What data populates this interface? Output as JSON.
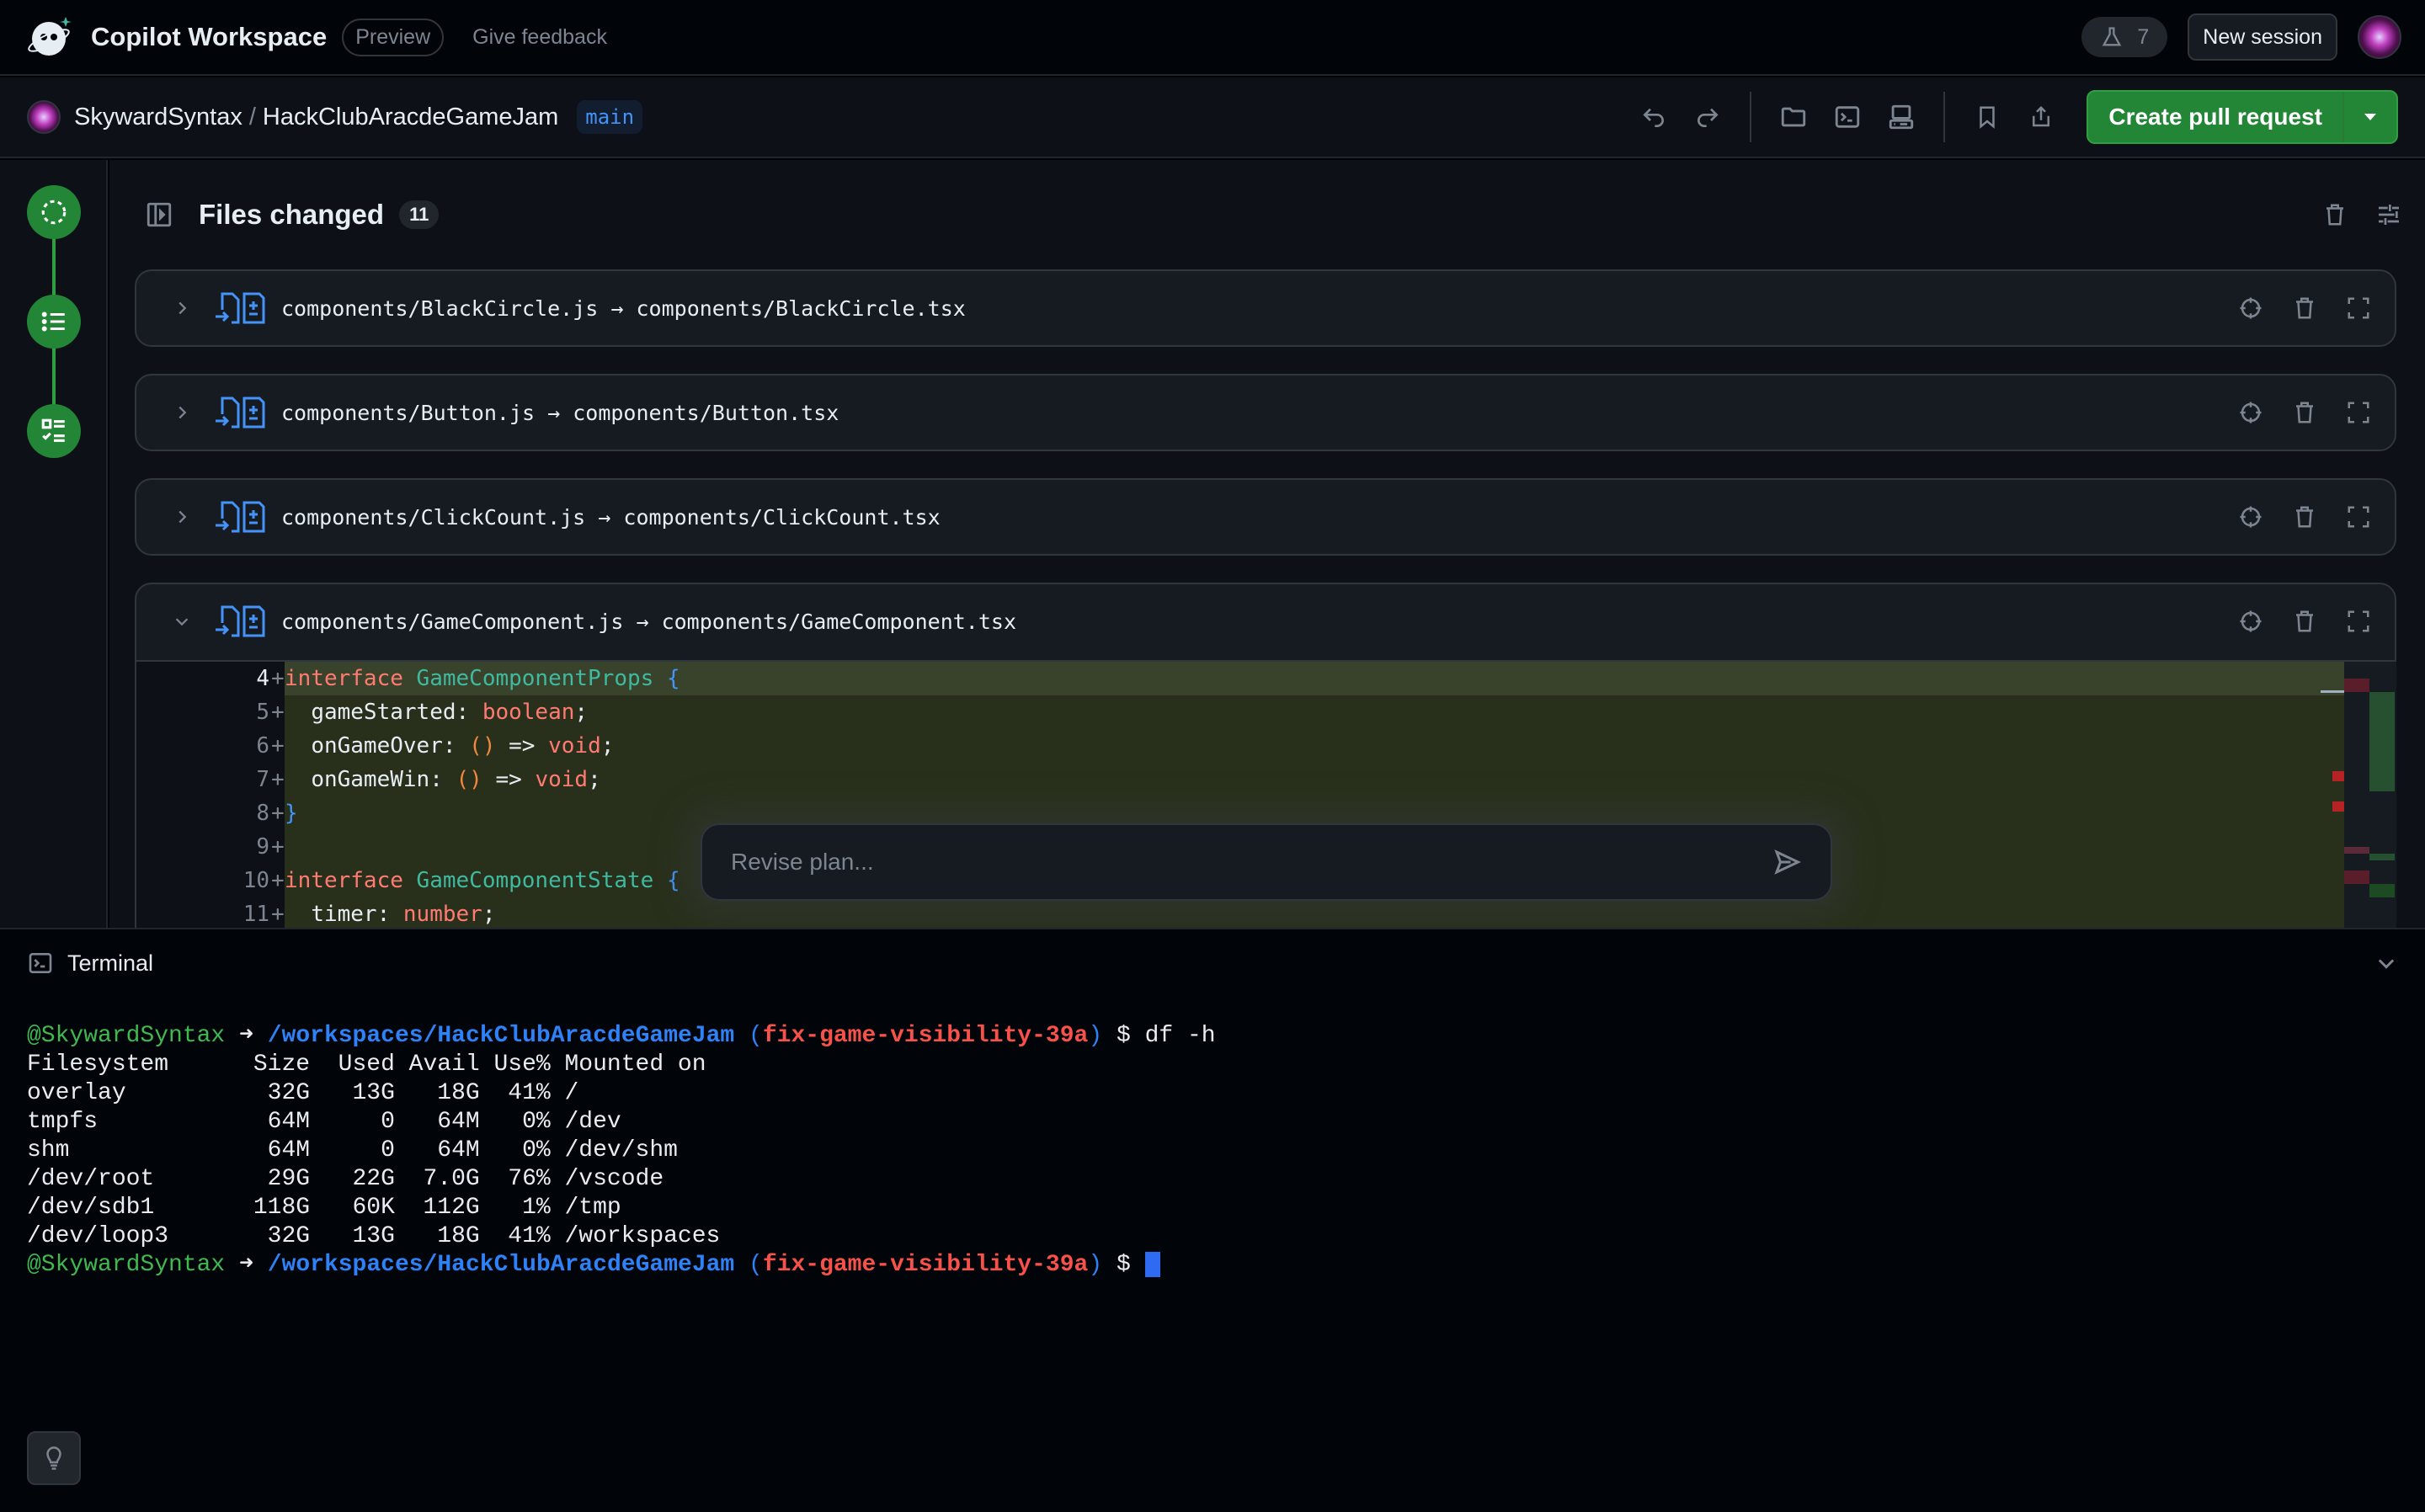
{
  "header": {
    "app_title": "Copilot Workspace",
    "preview_badge": "Preview",
    "feedback_link": "Give feedback",
    "flask_count": "7",
    "new_session_label": "New session"
  },
  "repo": {
    "owner": "SkywardSyntax",
    "separator": "/",
    "name": "HackClubAracdeGameJam",
    "branch": "main"
  },
  "toolbar": {
    "icons": [
      "undo-icon",
      "redo-icon",
      "folder-icon",
      "terminal-icon",
      "codespace-icon",
      "bookmark-icon",
      "share-icon"
    ],
    "create_pr_label": "Create pull request"
  },
  "rail": {
    "steps": [
      "spec-step",
      "plan-step",
      "implementation-step"
    ],
    "accent": "#238636"
  },
  "files": {
    "title": "Files changed",
    "count": "11",
    "items": [
      {
        "from": "components/BlackCircle.js",
        "arrow": "→",
        "to": "components/BlackCircle.tsx",
        "expanded": false
      },
      {
        "from": "components/Button.js",
        "arrow": "→",
        "to": "components/Button.tsx",
        "expanded": false
      },
      {
        "from": "components/ClickCount.js",
        "arrow": "→",
        "to": "components/ClickCount.tsx",
        "expanded": false
      },
      {
        "from": "components/GameComponent.js",
        "arrow": "→",
        "to": "components/GameComponent.tsx",
        "expanded": true
      }
    ]
  },
  "diff": {
    "lines": [
      {
        "num": "4",
        "marker": "+",
        "kw": "interface",
        "name": "GameComponentProps",
        "brace": "{"
      },
      {
        "num": "5",
        "marker": "+",
        "field": "gameStarted",
        "type": "boolean"
      },
      {
        "num": "6",
        "marker": "+",
        "field": "onGameOver",
        "sig": "() => void"
      },
      {
        "num": "7",
        "marker": "+",
        "field": "onGameWin",
        "sig": "() => void"
      },
      {
        "num": "8",
        "marker": "+",
        "brace": "}"
      },
      {
        "num": "9",
        "marker": "+"
      },
      {
        "num": "10",
        "marker": "+",
        "kw": "interface",
        "name": "GameComponentState",
        "brace": "{"
      },
      {
        "num": "11",
        "marker": "+",
        "field": "timer",
        "type": "number"
      }
    ]
  },
  "revise": {
    "placeholder": "Revise plan..."
  },
  "terminal": {
    "title": "Terminal",
    "prompt_user": "@SkywardSyntax",
    "prompt_arrow": "➜",
    "prompt_path": "/workspaces/HackClubAracdeGameJam",
    "prompt_branch": "fix-game-visibility-39a",
    "prompt_dollar": "$",
    "command": "df -h",
    "df_header": "Filesystem      Size  Used Avail Use% Mounted on",
    "df_rows": [
      "overlay          32G   13G   18G  41% /",
      "tmpfs            64M     0   64M   0% /dev",
      "shm              64M     0   64M   0% /dev/shm",
      "/dev/root        29G   22G  7.0G  76% /vscode",
      "/dev/sdb1       118G   60K  112G   1% /tmp",
      "/dev/loop3       32G   13G   18G  41% /workspaces"
    ]
  }
}
